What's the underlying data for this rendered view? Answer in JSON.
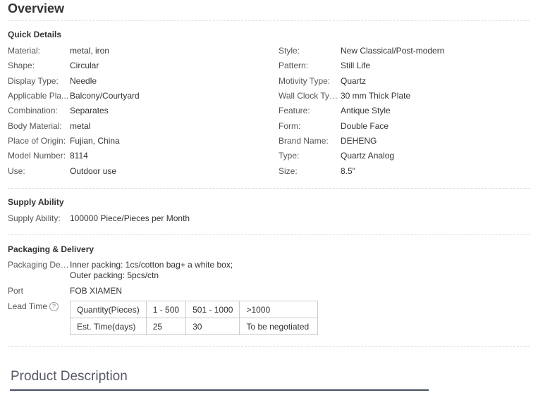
{
  "overview": {
    "title": "Overview"
  },
  "quick_details": {
    "title": "Quick Details",
    "left": [
      {
        "label": "Material:",
        "value": "metal, iron"
      },
      {
        "label": "Shape:",
        "value": "Circular"
      },
      {
        "label": "Display Type:",
        "value": "Needle"
      },
      {
        "label": "Applicable Pla...",
        "value": "Balcony/Courtyard"
      },
      {
        "label": "Combination:",
        "value": "Separates"
      },
      {
        "label": "Body Material:",
        "value": "metal"
      },
      {
        "label": "Place of Origin:",
        "value": "Fujian, China"
      },
      {
        "label": "Model Number:",
        "value": "8114"
      },
      {
        "label": "Use:",
        "value": "Outdoor use"
      }
    ],
    "right": [
      {
        "label": "Style:",
        "value": "New Classical/Post-modern"
      },
      {
        "label": "Pattern:",
        "value": "Still Life"
      },
      {
        "label": "Motivity Type:",
        "value": "Quartz"
      },
      {
        "label": "Wall Clock Type:",
        "value": "30 mm Thick Plate"
      },
      {
        "label": "Feature:",
        "value": "Antique Style"
      },
      {
        "label": "Form:",
        "value": "Double Face"
      },
      {
        "label": "Brand Name:",
        "value": "DEHENG"
      },
      {
        "label": "Type:",
        "value": "Quartz Analog"
      },
      {
        "label": "Size:",
        "value": "8.5\""
      }
    ]
  },
  "supply_ability": {
    "title": "Supply Ability",
    "label": "Supply Ability:",
    "value": "100000 Piece/Pieces per Month"
  },
  "packaging": {
    "title": "Packaging & Delivery",
    "details_label": "Packaging Det...",
    "details_line1": "Inner packing: 1cs/cotton bag+ a white box;",
    "details_line2": "Outer packing: 5pcs/ctn",
    "port_label": "Port",
    "port_value": "FOB XIAMEN",
    "lead_time_label": "Lead Time",
    "help_icon_glyph": "?",
    "lead_table": {
      "rows": [
        [
          "Quantity(Pieces)",
          "1 - 500",
          "501 - 1000",
          ">1000"
        ],
        [
          "Est. Time(days)",
          "25",
          "30",
          "To be negotiated"
        ]
      ]
    }
  },
  "product_description": {
    "title": "Product Description"
  }
}
